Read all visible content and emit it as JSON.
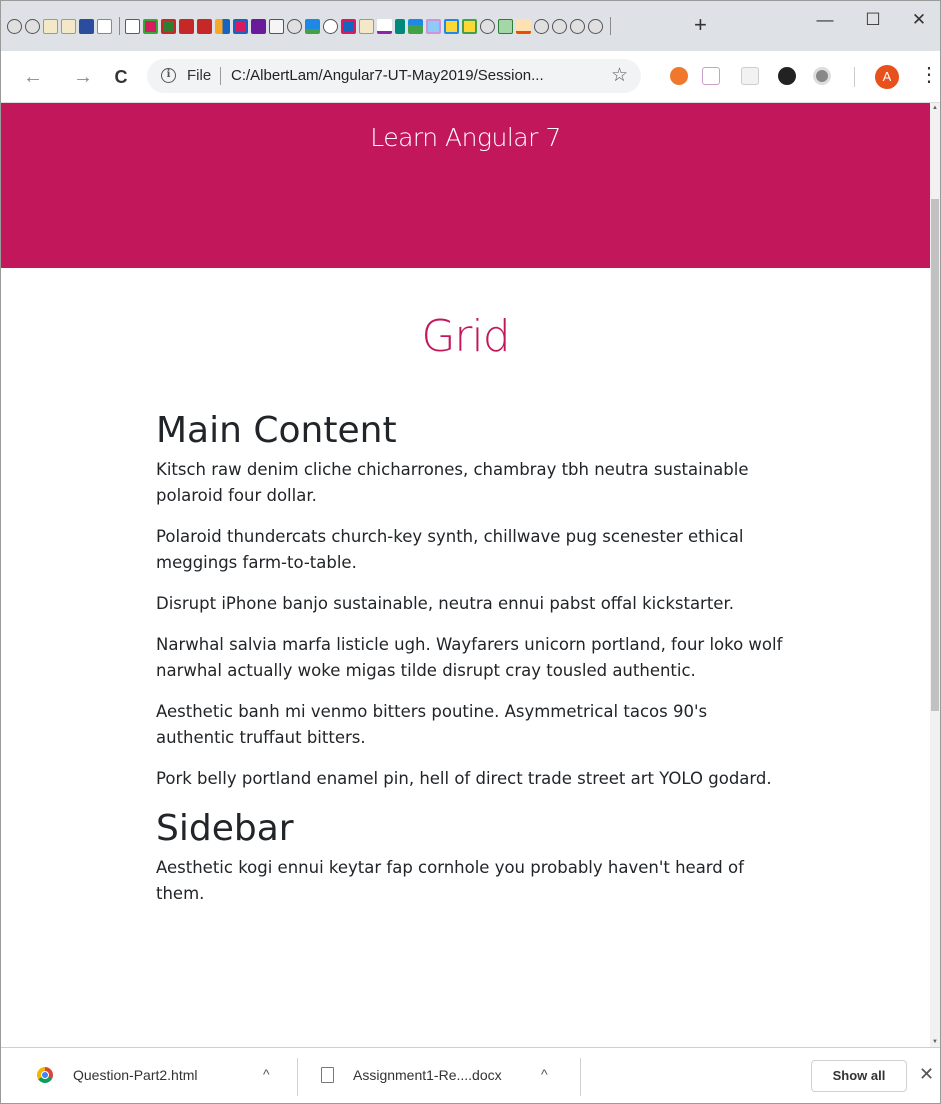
{
  "colors": {
    "accent": "#c2185b",
    "tabstrip": "#dee1e6",
    "text": "#212529"
  },
  "tabstrip": {
    "new_tab_label": "+",
    "minimize_label": "—",
    "maximize_label": "☐",
    "close_label": "✕"
  },
  "toolbar": {
    "back_icon": "←",
    "forward_icon": "→",
    "reload_icon": "C",
    "info_icon": "i",
    "file_label": "File",
    "url": "C:/AlbertLam/Angular7-UT-May2019/Session...",
    "star_icon": "☆",
    "profile_initial": "A",
    "menu_icon": "⋮"
  },
  "hero": {
    "subtitle": "Learn Angular 7"
  },
  "page": {
    "heading": "Grid",
    "main_heading": "Main Content",
    "paragraphs": [
      "Kitsch raw denim cliche chicharrones, chambray tbh neutra sustainable polaroid four dollar.",
      "Polaroid thundercats church-key synth, chillwave pug scenester ethical meggings farm-to-table.",
      "Disrupt iPhone banjo sustainable, neutra ennui pabst offal kickstarter.",
      "Narwhal salvia marfa listicle ugh. Wayfarers unicorn portland, four loko wolf narwhal actually woke migas tilde disrupt cray tousled authentic.",
      "Aesthetic banh mi venmo bitters poutine. Asymmetrical tacos 90's authentic truffaut bitters.",
      "Pork belly portland enamel pin, hell of direct trade street art YOLO godard."
    ],
    "sidebar_heading": "Sidebar",
    "sidebar_text": "Aesthetic kogi ennui keytar fap cornhole you probably haven't heard of them."
  },
  "downloads": {
    "items": [
      {
        "name": "Question-Part2.html",
        "icon": "chrome-icon"
      },
      {
        "name": "Assignment1-Re....docx",
        "icon": "document-icon"
      }
    ],
    "caret": "^",
    "show_all": "Show all",
    "close": "✕"
  }
}
